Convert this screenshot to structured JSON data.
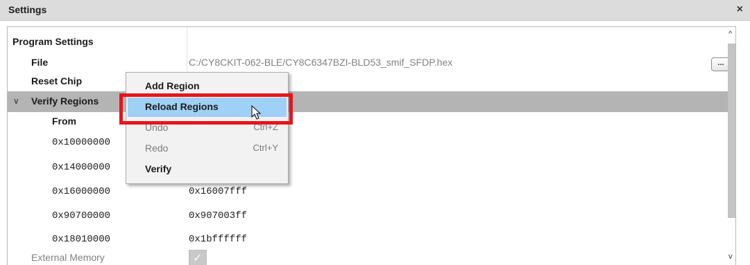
{
  "window": {
    "title": "Settings",
    "close_glyph": "×"
  },
  "tree": {
    "program_settings": "Program Settings",
    "file": {
      "label": "File",
      "value": "C:/CY8CKIT-062-BLE/CY8C6347BZI-BLD53_smif_SFDP.hex",
      "browse_label": "..."
    },
    "reset_chip": {
      "label": "Reset Chip"
    },
    "verify_regions": {
      "label": "Verify Regions",
      "expanded": true,
      "chevron": "∨"
    },
    "from_header": "From",
    "regions": [
      {
        "from": "0x10000000",
        "to": ""
      },
      {
        "from": "0x14000000",
        "to": ""
      },
      {
        "from": "0x16000000",
        "to": "0x16007fff"
      },
      {
        "from": "0x90700000",
        "to": "0x907003ff"
      },
      {
        "from": "0x18010000",
        "to": "0x1bffffff"
      }
    ],
    "external_memory": {
      "label": "External Memory",
      "checked": true,
      "disabled": true
    }
  },
  "context_menu": {
    "items": [
      {
        "label": "Add Region",
        "shortcut": "",
        "state": "normal"
      },
      {
        "label": "Reload Regions",
        "shortcut": "",
        "state": "hovered"
      },
      {
        "label": "Undo",
        "shortcut": "Ctrl+Z",
        "state": "disabled"
      },
      {
        "label": "Redo",
        "shortcut": "Ctrl+Y",
        "state": "disabled"
      },
      {
        "label": "Verify",
        "shortcut": "",
        "state": "normal"
      }
    ]
  },
  "annotation": {
    "highlight_color": "#e8141c"
  },
  "colors": {
    "titlebar": "#dcdcdc",
    "selected_row": "#b4b4b4",
    "menu_hover": "#9fd0f5",
    "menu_bg": "#f2f2f2"
  },
  "icons": {
    "close": "close-icon",
    "chevron": "chevron-down-icon",
    "check": "checkmark-icon",
    "scroll_up": "scroll-up-arrow-icon",
    "scroll_down": "scroll-down-arrow-icon",
    "cursor": "mouse-pointer-icon"
  }
}
